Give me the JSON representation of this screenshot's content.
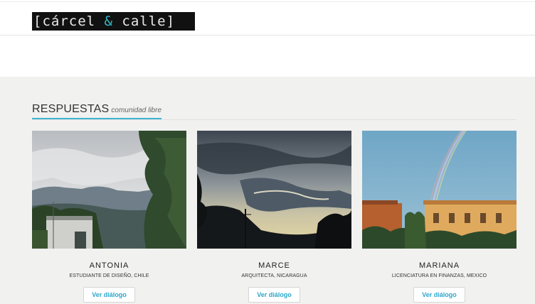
{
  "header": {
    "logo": {
      "prefix": "[cárcel ",
      "amp": "&",
      "suffix": " calle]"
    }
  },
  "section": {
    "title": "RESPUESTAS",
    "subtitle": "comunidad libre"
  },
  "cards": [
    {
      "name": "ANTONIA",
      "role": "ESTUDIANTE DE DISEÑO, CHILE",
      "button": "Ver diálogo"
    },
    {
      "name": "MARCE",
      "role": "ARQUITECTA, NICARAGUA",
      "button": "Ver diálogo"
    },
    {
      "name": "MARIANA",
      "role": "LICENCIATURA EN FINANZAS, MEXICO",
      "button": "Ver diálogo"
    }
  ],
  "colors": {
    "accent": "#3fb3d1",
    "link": "#2aa6cb",
    "logo_bg": "#111111"
  }
}
